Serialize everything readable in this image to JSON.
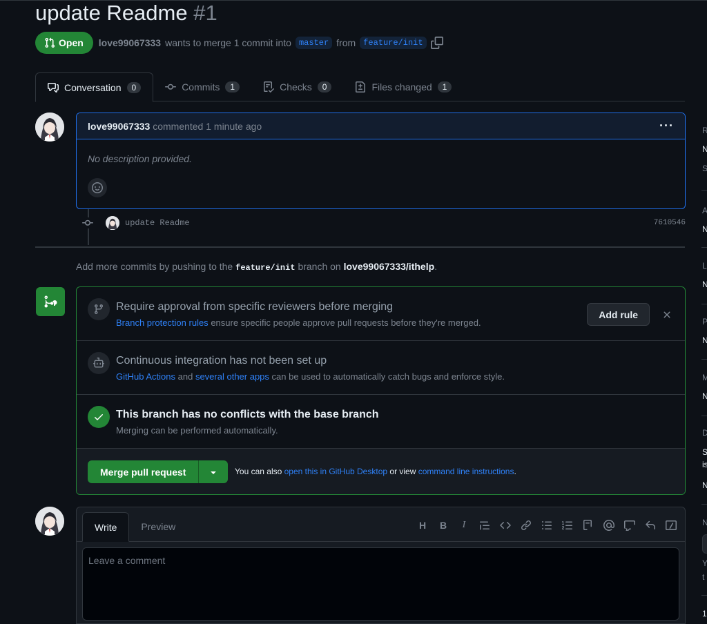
{
  "pr": {
    "title": "update Readme",
    "number": "#1",
    "state": "Open",
    "author": "love99067333",
    "summary": "wants to merge 1 commit into",
    "base": "master",
    "from_word": "from",
    "head": "feature/init"
  },
  "tabs": [
    {
      "label": "Conversation",
      "count": "0"
    },
    {
      "label": "Commits",
      "count": "1"
    },
    {
      "label": "Checks",
      "count": "0"
    },
    {
      "label": "Files changed",
      "count": "1"
    }
  ],
  "comment": {
    "author": "love99067333",
    "meta": "commented 1 minute ago",
    "body": "No description provided.",
    "more": "···"
  },
  "commit": {
    "message": "update Readme",
    "sha": "7610546"
  },
  "hint": {
    "pre": "Add more commits by pushing to the",
    "branch": "feature/init",
    "mid": "branch on",
    "repo": "love99067333/ithelp",
    "post": "."
  },
  "merge": {
    "rule_title": "Require approval from specific reviewers before merging",
    "rule_link": "Branch protection rules",
    "rule_sub": "ensure specific people approve pull requests before they're merged.",
    "add_rule": "Add rule",
    "ci_title": "Continuous integration has not been set up",
    "ci_link1": "GitHub Actions",
    "ci_and": "and",
    "ci_link2": "several other apps",
    "ci_sub": "can be used to automatically catch bugs and enforce style.",
    "check_title": "This branch has no conflicts with the base branch",
    "check_sub": "Merging can be performed automatically.",
    "merge_button": "Merge pull request",
    "note_pre": "You can also",
    "note_link1": "open this in GitHub Desktop",
    "note_mid": "or view",
    "note_link2": "command line instructions",
    "note_post": "."
  },
  "form": {
    "write_tab": "Write",
    "preview_tab": "Preview",
    "placeholder": "Leave a comment",
    "toolbar": [
      "heading-icon",
      "bold-icon",
      "italic-icon",
      "quote-icon",
      "code-icon",
      "link-icon",
      "bullet-list-icon",
      "numbered-list-icon",
      "task-list-icon",
      "mention-icon",
      "reference-icon",
      "reply-icon",
      "slash-command-icon"
    ]
  },
  "sidebar_letters": [
    "R",
    "N",
    "S",
    "A",
    "N",
    "L",
    "N",
    "P",
    "N",
    "M",
    "N",
    "D",
    "S",
    "is",
    "N",
    "N",
    "Y",
    "t",
    "1"
  ],
  "colors": {
    "accent_green": "#238636",
    "link_blue": "#2f81f7",
    "background": "#0d1117"
  }
}
